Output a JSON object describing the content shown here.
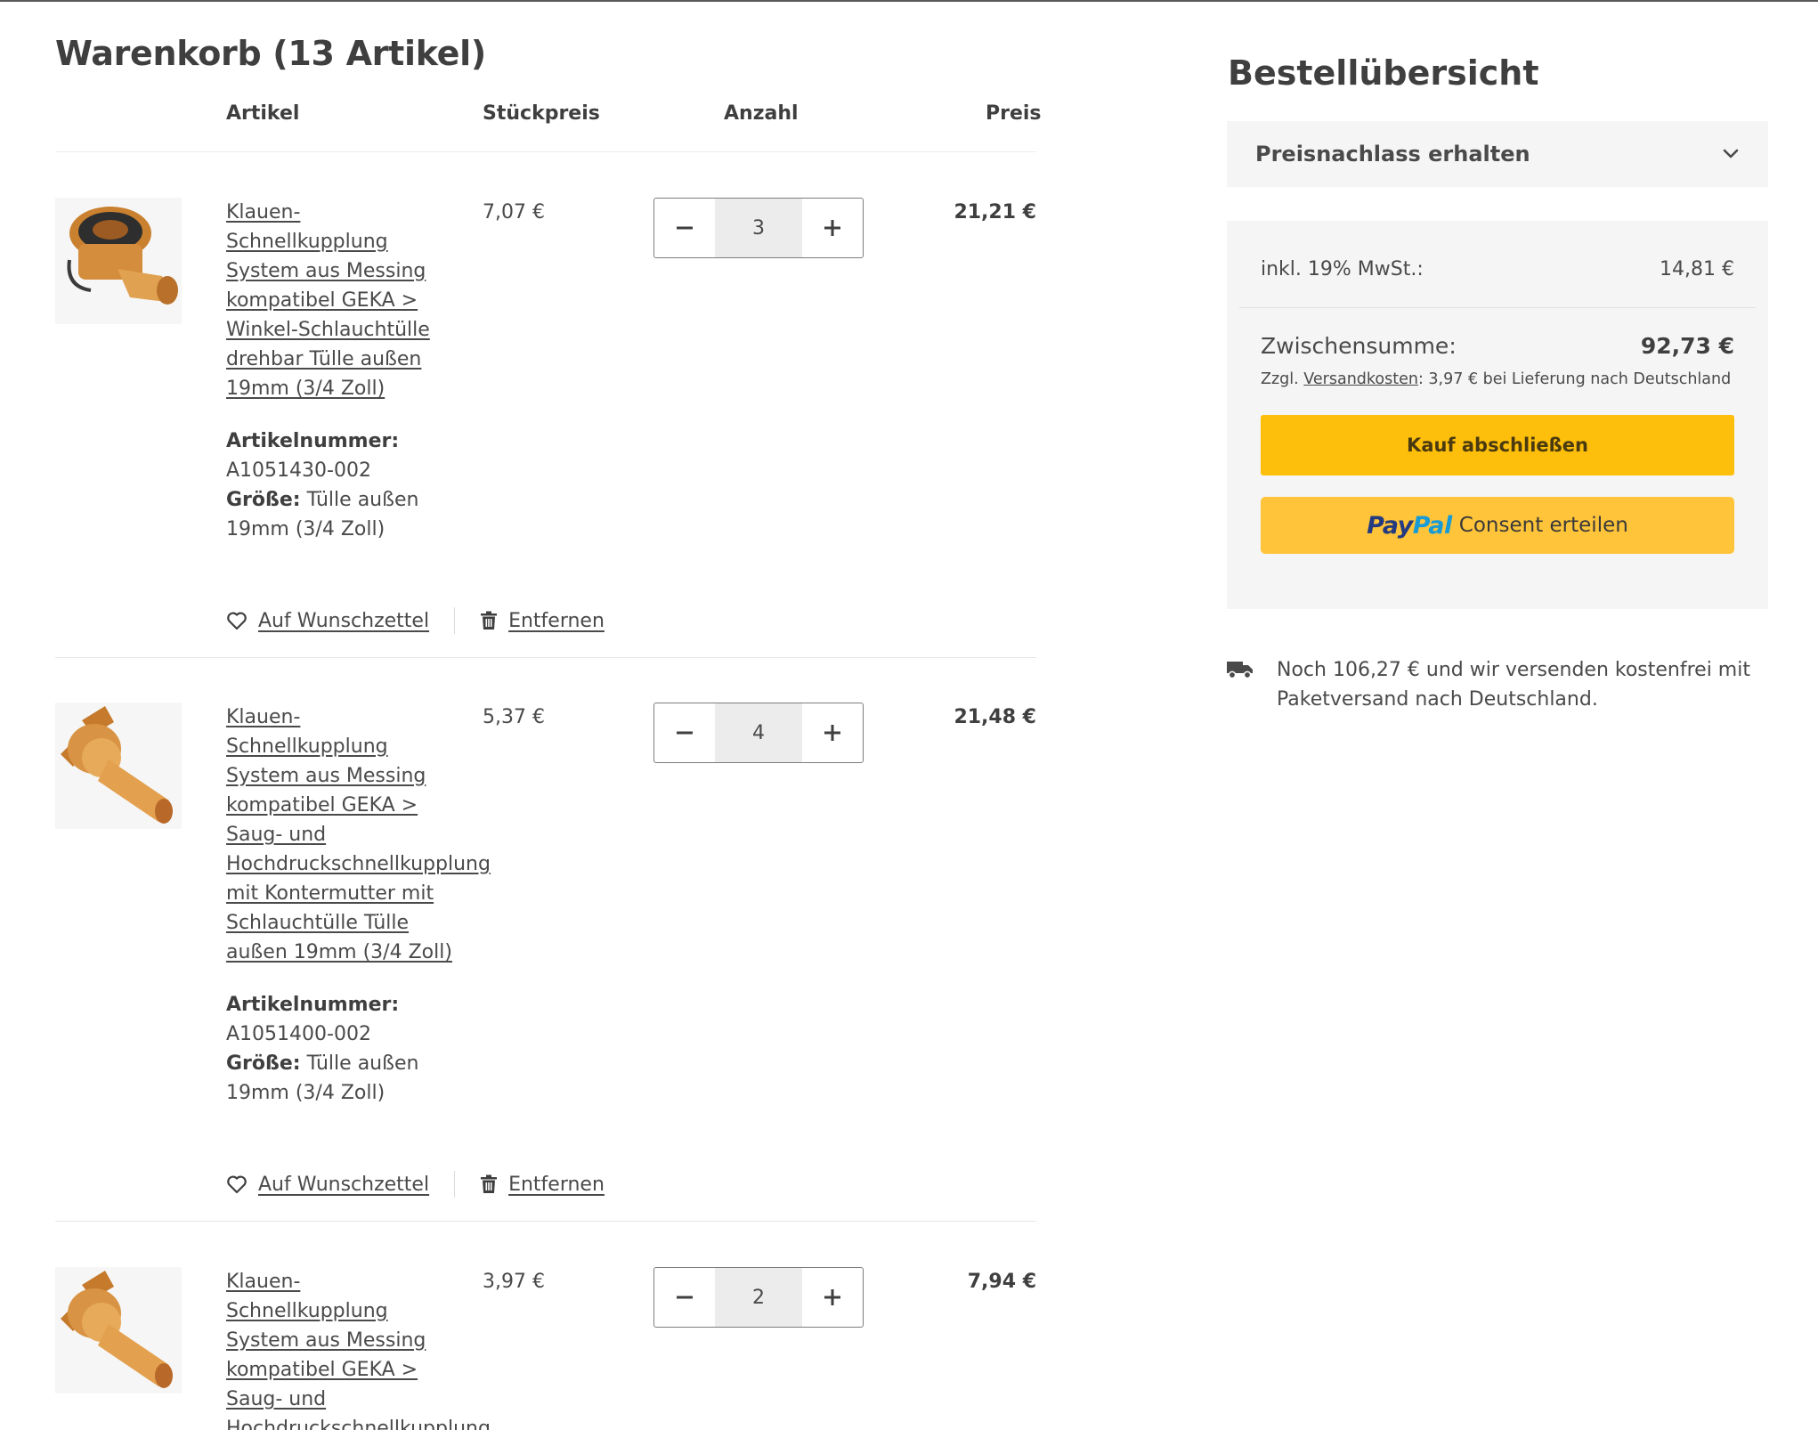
{
  "cart": {
    "title": "Warenkorb (13 Artikel)",
    "headers": {
      "article": "Artikel",
      "unit_price": "Stückpreis",
      "quantity": "Anzahl",
      "price": "Preis"
    }
  },
  "items": [
    {
      "name_lines": [
        "Klauen-",
        "Schnellkupplung",
        "System aus Messing",
        "kompatibel GEKA >",
        "Winkel-Schlauchtülle",
        "drehbar Tülle außen",
        "19mm (3/4 Zoll)"
      ],
      "article_label": "Artikelnummer:",
      "article_number": "A1051430-002",
      "size_label": "Größe:",
      "size_value_1": " Tülle außen",
      "size_value_2": "19mm (3/4 Zoll)",
      "unit_price": "7,07 €",
      "quantity": "3",
      "line_price": "21,21 €",
      "wishlist_label": "Auf Wunschzettel",
      "remove_label": "Entfernen"
    },
    {
      "name_lines": [
        "Klauen-",
        "Schnellkupplung",
        "System aus Messing",
        "kompatibel GEKA >",
        "Saug- und",
        "Hochdruckschnellkupplung",
        "mit Kontermutter mit",
        "Schlauchtülle Tülle",
        "außen 19mm (3/4 Zoll)"
      ],
      "article_label": "Artikelnummer:",
      "article_number": "A1051400-002",
      "size_label": "Größe:",
      "size_value_1": " Tülle außen",
      "size_value_2": "19mm (3/4 Zoll)",
      "unit_price": "5,37 €",
      "quantity": "4",
      "line_price": "21,48 €",
      "wishlist_label": "Auf Wunschzettel",
      "remove_label": "Entfernen"
    },
    {
      "name_lines": [
        "Klauen-",
        "Schnellkupplung",
        "System aus Messing",
        "kompatibel GEKA >",
        "Saug- und",
        "Hochdruckschnellkupplung"
      ],
      "unit_price": "3,97 €",
      "quantity": "2",
      "line_price": "7,94 €"
    }
  ],
  "summary": {
    "title": "Bestellübersicht",
    "discount_label": "Preisnachlass erhalten",
    "vat_label": "inkl. 19% MwSt.:",
    "vat_value": "14,81 €",
    "subtotal_label": "Zwischensumme:",
    "subtotal_value": "92,73 €",
    "shipping_prefix": "Zzgl. ",
    "shipping_link": "Versandkosten",
    "shipping_suffix": ": 3,97 € bei Lieferung nach Deutschland",
    "checkout_label": "Kauf abschließen",
    "paypal_pay": "Pay",
    "paypal_pal": "Pal",
    "paypal_text": "Consent erteilen",
    "free_shipping_1": "Noch 106,27 € und wir versenden kostenfrei mit",
    "free_shipping_2": "Paketversand nach Deutschland."
  },
  "colors": {
    "accent_yellow": "#fdbf0b",
    "paypal_yellow": "#ffc439",
    "paypal_dark_blue": "#253b80",
    "paypal_light_blue": "#179bd7",
    "text": "#4a4a4a"
  },
  "icons": {
    "quantity_decrease": "minus-icon",
    "quantity_increase": "plus-icon",
    "wishlist": "heart-icon",
    "remove": "trash-icon",
    "discount_toggle": "chevron-down-icon",
    "shipping": "truck-icon"
  }
}
